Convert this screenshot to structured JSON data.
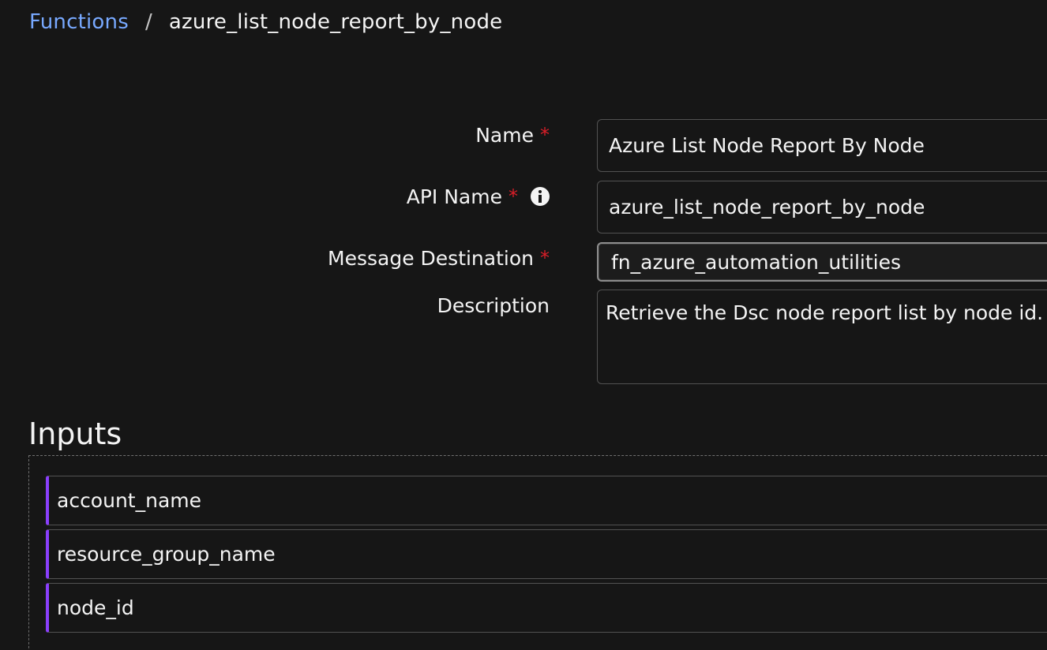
{
  "breadcrumb": {
    "parent": "Functions",
    "separator": "/",
    "current": "azure_list_node_report_by_node"
  },
  "form": {
    "name": {
      "label": "Name",
      "required_mark": "*",
      "value": "Azure List Node Report By Node"
    },
    "api_name": {
      "label": "API Name",
      "required_mark": "*",
      "value": "azure_list_node_report_by_node",
      "icon": "info-icon"
    },
    "message_destination": {
      "label": "Message Destination",
      "required_mark": "*",
      "value": "fn_azure_automation_utilities"
    },
    "description": {
      "label": "Description",
      "value": "Retrieve the Dsc node report list by node id."
    }
  },
  "inputs": {
    "title": "Inputs",
    "items": [
      {
        "label": "account_name"
      },
      {
        "label": "resource_group_name"
      },
      {
        "label": "node_id"
      }
    ]
  },
  "colors": {
    "background": "#161616",
    "link": "#78a9ff",
    "required": "#da1e28",
    "input_accent": "#8a3ffc"
  }
}
